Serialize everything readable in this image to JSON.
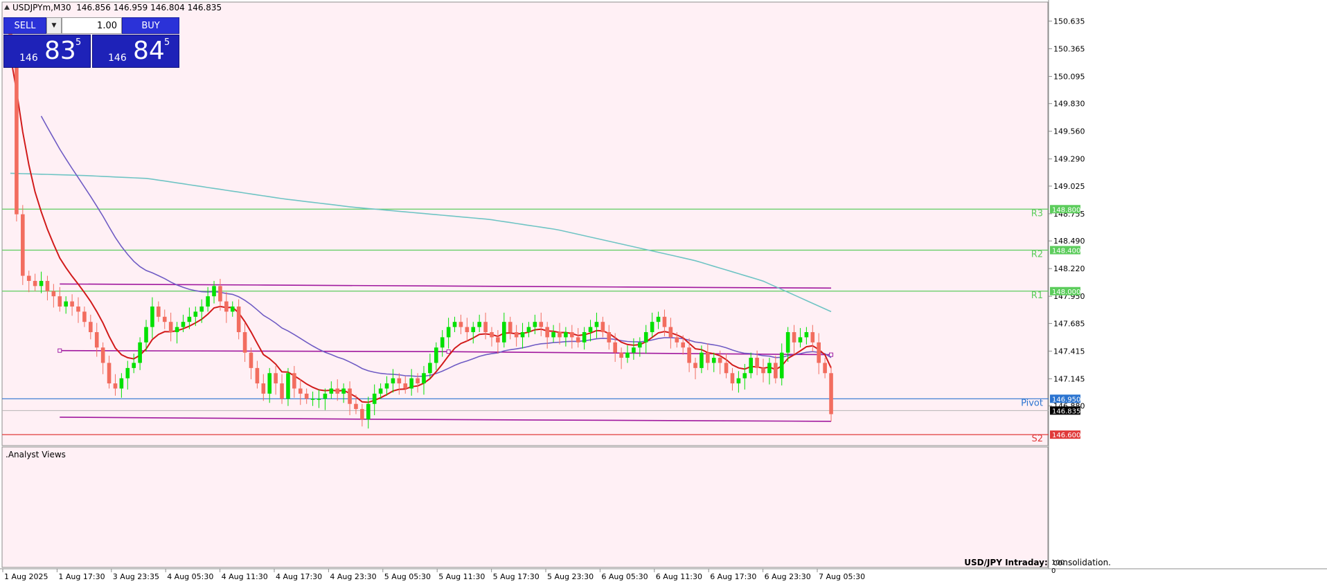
{
  "header": {
    "symbol": "USDJPYm,M30",
    "ohlc": "146.856 146.959 146.804 146.835"
  },
  "trade_panel": {
    "sell_label": "SELL",
    "buy_label": "BUY",
    "volume": "1.00",
    "sell_price_small": "146",
    "sell_price_big": "83",
    "sell_price_sup": "5",
    "buy_price_small": "146",
    "buy_price_big": "84",
    "buy_price_sup": "5"
  },
  "indicator_window": {
    "name": ".Analyst Views",
    "scale_top": "100",
    "scale_bottom": "0"
  },
  "analyst_note": {
    "title": "USD/JPY Intraday:",
    "text": "consolidation."
  },
  "colors": {
    "background": "#fff0f5",
    "bull_candle": "#00e000",
    "bear_candle": "#f26d5f",
    "ma_fast": "#d11a1a",
    "ma_mid": "#6f5bc4",
    "ma_slow": "#6fc4c4",
    "channel": "#a0189e",
    "resistance": "#5ccc5c",
    "pivot": "#2b74d0",
    "support": "#e03a3a"
  },
  "chart_data": {
    "type": "candlestick",
    "symbol": "USDJPYm",
    "timeframe": "M30",
    "y_range": [
      146.52,
      150.8
    ],
    "y_ticks": [
      "150.635",
      "150.365",
      "150.095",
      "149.830",
      "149.560",
      "149.290",
      "149.025",
      "148.755",
      "148.490",
      "148.220",
      "147.950",
      "147.685",
      "147.415",
      "147.145",
      "146.880"
    ],
    "x_labels": [
      "1 Aug 2025",
      "1 Aug 17:30",
      "3 Aug 23:35",
      "4 Aug 05:30",
      "4 Aug 11:30",
      "4 Aug 17:30",
      "4 Aug 23:30",
      "5 Aug 05:30",
      "5 Aug 11:30",
      "5 Aug 17:30",
      "5 Aug 23:30",
      "6 Aug 05:30",
      "6 Aug 11:30",
      "6 Aug 17:30",
      "6 Aug 23:30",
      "7 Aug 05:30"
    ],
    "levels": [
      {
        "name": "R3",
        "value": 148.8,
        "label": "148.800"
      },
      {
        "name": "R2",
        "value": 148.4,
        "label": "148.400"
      },
      {
        "name": "R1",
        "value": 148.0,
        "label": "148.000"
      },
      {
        "name": "Pivot",
        "value": 146.95,
        "label": "146.950"
      },
      {
        "name": "S2",
        "value": 146.6,
        "label": "146.600"
      }
    ],
    "current_price": {
      "value": 146.835,
      "label": "146.835"
    },
    "close": [
      150.3,
      148.75,
      148.15,
      148.1,
      148.05,
      148.1,
      148.0,
      147.95,
      147.85,
      147.9,
      147.85,
      147.8,
      147.7,
      147.6,
      147.45,
      147.3,
      147.1,
      147.05,
      147.15,
      147.25,
      147.3,
      147.5,
      147.65,
      147.85,
      147.75,
      147.7,
      147.6,
      147.65,
      147.7,
      147.75,
      147.8,
      147.85,
      147.95,
      148.05,
      147.9,
      147.8,
      147.85,
      147.6,
      147.4,
      147.25,
      147.1,
      147.0,
      147.2,
      147.1,
      146.95,
      147.2,
      147.05,
      147.0,
      146.95,
      146.95,
      146.95,
      147.0,
      147.05,
      147.0,
      147.05,
      146.9,
      146.85,
      146.75,
      146.9,
      147.0,
      147.05,
      147.1,
      147.15,
      147.1,
      147.05,
      147.15,
      147.1,
      147.2,
      147.3,
      147.45,
      147.55,
      147.65,
      147.7,
      147.65,
      147.6,
      147.65,
      147.7,
      147.6,
      147.55,
      147.5,
      147.7,
      147.6,
      147.55,
      147.6,
      147.65,
      147.7,
      147.65,
      147.55,
      147.6,
      147.55,
      147.6,
      147.55,
      147.5,
      147.6,
      147.65,
      147.7,
      147.6,
      147.5,
      147.4,
      147.35,
      147.4,
      147.45,
      147.5,
      147.6,
      147.7,
      147.75,
      147.65,
      147.55,
      147.5,
      147.45,
      147.3,
      147.25,
      147.4,
      147.3,
      147.35,
      147.3,
      147.2,
      147.1,
      147.15,
      147.2,
      147.35,
      147.25,
      147.2,
      147.3,
      147.15,
      147.4,
      147.6,
      147.5,
      147.55,
      147.6,
      147.5,
      147.3,
      147.2,
      146.8
    ]
  }
}
